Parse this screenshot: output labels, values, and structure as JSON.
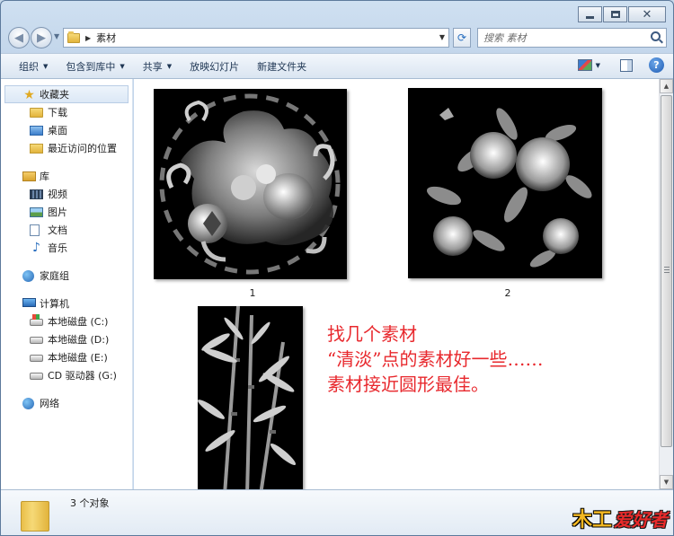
{
  "window": {
    "minimize_icon": "minimize-icon",
    "maximize_icon": "maximize-icon",
    "close_icon": "close-icon"
  },
  "address_bar": {
    "breadcrumb": [
      "素材"
    ],
    "search_placeholder": "搜索 素材"
  },
  "toolbar": {
    "organize": "组织",
    "include_in_library": "包含到库中",
    "share": "共享",
    "slideshow": "放映幻灯片",
    "new_folder": "新建文件夹"
  },
  "sidebar": {
    "favorites": {
      "label": "收藏夹",
      "items": [
        {
          "label": "下载",
          "icon": "downloads-folder-icon"
        },
        {
          "label": "桌面",
          "icon": "desktop-icon"
        },
        {
          "label": "最近访问的位置",
          "icon": "recent-places-icon"
        }
      ]
    },
    "libraries": {
      "label": "库",
      "items": [
        {
          "label": "视频",
          "icon": "video-library-icon"
        },
        {
          "label": "图片",
          "icon": "pictures-library-icon"
        },
        {
          "label": "文档",
          "icon": "documents-library-icon"
        },
        {
          "label": "音乐",
          "icon": "music-library-icon"
        }
      ]
    },
    "homegroup": {
      "label": "家庭组"
    },
    "computer": {
      "label": "计算机",
      "items": [
        {
          "label": "本地磁盘 (C:)",
          "icon": "system-drive-icon"
        },
        {
          "label": "本地磁盘 (D:)",
          "icon": "hard-drive-icon"
        },
        {
          "label": "本地磁盘 (E:)",
          "icon": "hard-drive-icon"
        },
        {
          "label": "CD 驱动器 (G:)",
          "icon": "cd-drive-icon"
        }
      ]
    },
    "network": {
      "label": "网络"
    }
  },
  "files": [
    {
      "name": "1",
      "kind": "qilin-lion-relief"
    },
    {
      "name": "2",
      "kind": "peony-flowers-relief"
    },
    {
      "name": "",
      "kind": "bamboo-relief"
    }
  ],
  "annotation": {
    "line1": "找几个素材",
    "line2": "“清淡”点的素材好一些……",
    "line3": "素材接近圆形最佳。",
    "color": "#e8282d"
  },
  "status": {
    "count": "3 个对象"
  },
  "watermark": {
    "mu": "木工",
    "text": "爱好者"
  }
}
